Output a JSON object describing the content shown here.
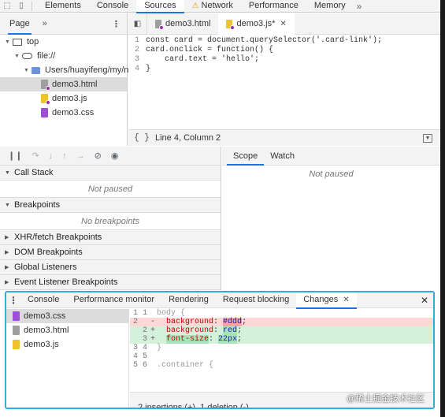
{
  "devtools_tabs": [
    "Elements",
    "Console",
    "Sources",
    "Network",
    "Performance",
    "Memory"
  ],
  "navigator": {
    "tab": "Page",
    "tree": [
      {
        "label": "top"
      },
      {
        "label": "file://"
      },
      {
        "label": "Users/huayifeng/my/n"
      },
      {
        "label": "demo3.html"
      },
      {
        "label": "demo3.js"
      },
      {
        "label": "demo3.css"
      }
    ]
  },
  "editor": {
    "tabs": [
      {
        "label": "demo3.html"
      },
      {
        "label": "demo3.js*"
      }
    ],
    "lines": [
      {
        "n": "1",
        "code": "const card = document.querySelector('.card-link');"
      },
      {
        "n": "2",
        "code": "card.onclick = function() {"
      },
      {
        "n": "3",
        "code": "    card.text = 'hello';"
      },
      {
        "n": "4",
        "code": "}"
      }
    ],
    "status": "Line 4, Column 2"
  },
  "debugger": {
    "sections": [
      {
        "title": "Call Stack",
        "empty": "Not paused"
      },
      {
        "title": "Breakpoints",
        "empty": "No breakpoints"
      },
      {
        "title": "XHR/fetch Breakpoints"
      },
      {
        "title": "DOM Breakpoints"
      },
      {
        "title": "Global Listeners"
      },
      {
        "title": "Event Listener Breakpoints"
      }
    ],
    "scope_tabs": [
      "Scope",
      "Watch"
    ],
    "scope_empty": "Not paused"
  },
  "drawer": {
    "tabs": [
      "Console",
      "Performance monitor",
      "Rendering",
      "Request blocking",
      "Changes"
    ],
    "files": [
      "demo3.css",
      "demo3.html",
      "demo3.js"
    ],
    "diff": [
      {
        "n1": "1",
        "n2": "1",
        "mark": "",
        "type": "ctx",
        "text": "body {"
      },
      {
        "n1": "2",
        "n2": "",
        "mark": "-",
        "type": "del",
        "prop": "background",
        "value": "#ddd"
      },
      {
        "n1": "",
        "n2": "2",
        "mark": "+",
        "type": "add",
        "prop": "background",
        "value": "red"
      },
      {
        "n1": "",
        "n2": "3",
        "mark": "+",
        "type": "add",
        "prop": "font-size",
        "value": "22px"
      },
      {
        "n1": "3",
        "n2": "4",
        "mark": "",
        "type": "ctx",
        "text": "}"
      },
      {
        "n1": "4",
        "n2": "5",
        "mark": "",
        "type": "ctx",
        "text": ""
      },
      {
        "n1": "5",
        "n2": "6",
        "mark": "",
        "type": "ctx",
        "text": ".container {"
      }
    ],
    "summary": "2 insertions (+), 1 deletion (-)"
  },
  "watermark": "@稀土掘金技术社区"
}
